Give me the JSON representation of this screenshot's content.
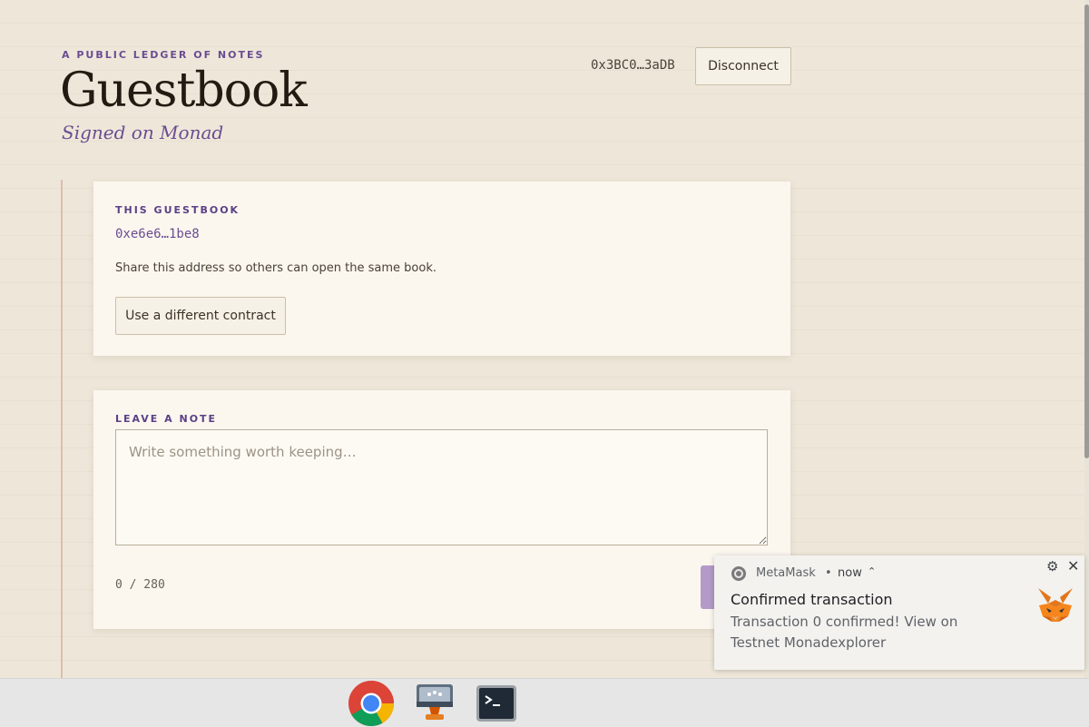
{
  "header": {
    "eyebrow": "A PUBLIC LEDGER OF NOTES",
    "title": "Guestbook",
    "subtitle": "Signed on Monad",
    "wallet_address": "0x3BC0…3aDB",
    "disconnect_label": "Disconnect"
  },
  "guestbook_card": {
    "label": "THIS GUESTBOOK",
    "contract_address": "0xe6e6…1be8",
    "helper_text": "Share this address so others can open the same book.",
    "different_contract_label": "Use a different contract"
  },
  "note_card": {
    "label": "LEAVE A NOTE",
    "placeholder": "Write something worth keeping…",
    "char_count": "0 / 280"
  },
  "notification": {
    "app_name": "MetaMask",
    "separator": "•",
    "time": "now",
    "caret": "⌃",
    "title": "Confirmed transaction",
    "body": "Transaction 0 confirmed! View on Testnet Monadexplorer",
    "settings_icon": "gear-icon",
    "close_icon": "close-icon",
    "fox_icon": "metamask-fox-icon"
  },
  "taskbar": {
    "apps": [
      "chrome-icon",
      "web-store-icon",
      "terminal-icon"
    ]
  },
  "colors": {
    "accent": "#6b4c92",
    "button_disabled": "#b49ac8",
    "background": "#eee7d9",
    "card": "#fbf7ef"
  }
}
